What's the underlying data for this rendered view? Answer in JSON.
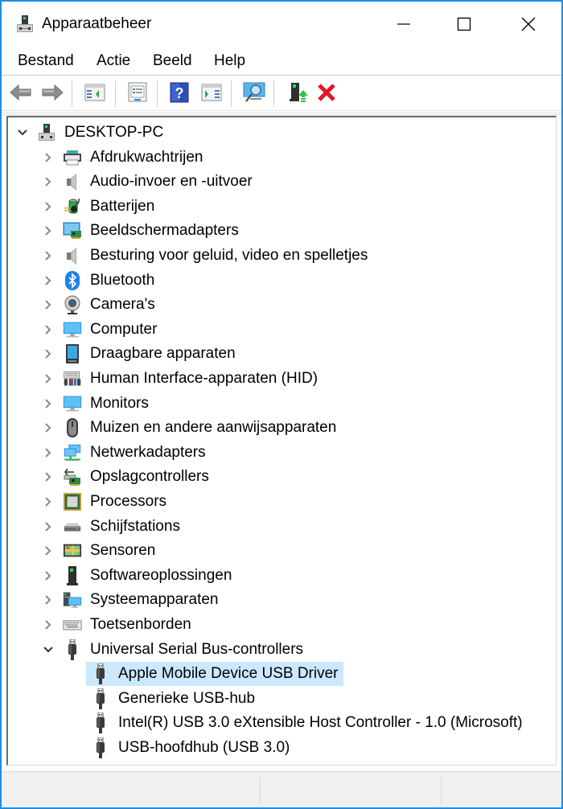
{
  "window": {
    "title": "Apparaatbeheer",
    "icon": "device-manager-icon",
    "controls": {
      "minimize": "minimize-icon",
      "maximize": "maximize-icon",
      "close": "close-icon"
    },
    "accent_color": "#1b8fe6"
  },
  "menu": {
    "items": [
      {
        "label": "Bestand"
      },
      {
        "label": "Actie"
      },
      {
        "label": "Beeld"
      },
      {
        "label": "Help"
      }
    ]
  },
  "toolbar": {
    "buttons": [
      {
        "name": "back",
        "icon": "arrow-left-icon"
      },
      {
        "name": "forward",
        "icon": "arrow-right-icon"
      },
      {
        "name": "show-hide-console-tree",
        "icon": "console-tree-icon"
      },
      {
        "name": "properties",
        "icon": "properties-icon"
      },
      {
        "name": "help",
        "icon": "help-icon"
      },
      {
        "name": "show-hide-action-pane",
        "icon": "action-pane-icon"
      },
      {
        "name": "scan-hardware-changes",
        "icon": "scan-monitor-icon"
      },
      {
        "name": "update-driver",
        "icon": "update-driver-icon"
      },
      {
        "name": "uninstall-device",
        "icon": "uninstall-x-icon"
      }
    ]
  },
  "tree": {
    "root": {
      "label": "DESKTOP-PC",
      "expanded": true,
      "icon": "computer-tower-icon"
    },
    "categories": [
      {
        "label": "Afdrukwachtrijen",
        "icon": "printer-icon",
        "expanded": false
      },
      {
        "label": "Audio-invoer en -uitvoer",
        "icon": "speaker-icon",
        "expanded": false
      },
      {
        "label": "Batterijen",
        "icon": "battery-icon",
        "expanded": false
      },
      {
        "label": "Beeldschermadapters",
        "icon": "display-adapter-icon",
        "expanded": false
      },
      {
        "label": "Besturing voor geluid, video en spelletjes",
        "icon": "speaker-icon",
        "expanded": false
      },
      {
        "label": "Bluetooth",
        "icon": "bluetooth-icon",
        "expanded": false
      },
      {
        "label": "Camera's",
        "icon": "webcam-icon",
        "expanded": false
      },
      {
        "label": "Computer",
        "icon": "monitor-icon",
        "expanded": false
      },
      {
        "label": "Draagbare apparaten",
        "icon": "portable-device-icon",
        "expanded": false
      },
      {
        "label": "Human Interface-apparaten (HID)",
        "icon": "hid-icon",
        "expanded": false
      },
      {
        "label": "Monitors",
        "icon": "monitor-icon",
        "expanded": false
      },
      {
        "label": "Muizen en andere aanwijsapparaten",
        "icon": "mouse-icon",
        "expanded": false
      },
      {
        "label": "Netwerkadapters",
        "icon": "network-icon",
        "expanded": false
      },
      {
        "label": "Opslagcontrollers",
        "icon": "storage-controller-icon",
        "expanded": false
      },
      {
        "label": "Processors",
        "icon": "processor-icon",
        "expanded": false
      },
      {
        "label": "Schijfstations",
        "icon": "disk-drive-icon",
        "expanded": false
      },
      {
        "label": "Sensoren",
        "icon": "sensor-map-icon",
        "expanded": false
      },
      {
        "label": "Softwareoplossingen",
        "icon": "software-component-icon",
        "expanded": false
      },
      {
        "label": "Systeemapparaten",
        "icon": "system-devices-icon",
        "expanded": false
      },
      {
        "label": "Toetsenborden",
        "icon": "keyboard-icon",
        "expanded": false
      },
      {
        "label": "Universal Serial Bus-controllers",
        "icon": "usb-plug-icon",
        "expanded": true
      }
    ],
    "usb_children": [
      {
        "label": "Apple Mobile Device USB Driver",
        "icon": "usb-plug-icon",
        "selected": true
      },
      {
        "label": "Generieke USB-hub",
        "icon": "usb-plug-icon",
        "selected": false
      },
      {
        "label": "Intel(R) USB 3.0 eXtensible Host Controller - 1.0 (Microsoft)",
        "icon": "usb-plug-icon",
        "selected": false
      },
      {
        "label": "USB-hoofdhub (USB 3.0)",
        "icon": "usb-plug-icon",
        "selected": false
      }
    ],
    "selection_color": "#cce8ff"
  },
  "statusbar": {
    "sections": [
      "",
      "",
      ""
    ]
  }
}
